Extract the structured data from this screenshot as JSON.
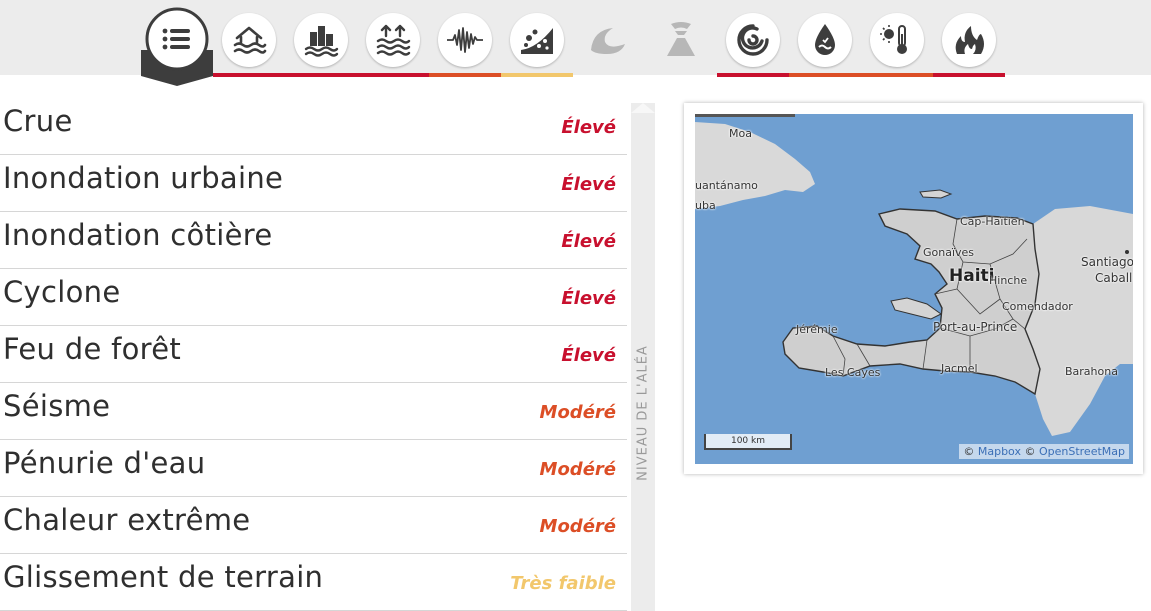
{
  "colors": {
    "high": "#c8102e",
    "medium": "#dc4e26",
    "very_low": "#f2c76c",
    "icon_dark": "#3d3d3d",
    "icon_disabled": "#b7b7b7"
  },
  "hazard_toolbar": {
    "list_icon": "list-icon",
    "icons": [
      {
        "name": "river-flood-icon",
        "level": "high"
      },
      {
        "name": "urban-flood-icon",
        "level": "high"
      },
      {
        "name": "coastal-flood-icon",
        "level": "high"
      },
      {
        "name": "earthquake-icon",
        "level": "medium"
      },
      {
        "name": "landslide-icon",
        "level": "very_low"
      },
      {
        "name": "tsunami-icon",
        "level": "none"
      },
      {
        "name": "volcano-icon",
        "level": "none"
      },
      {
        "name": "cyclone-icon",
        "level": "high"
      },
      {
        "name": "water-scarcity-icon",
        "level": "medium"
      },
      {
        "name": "extreme-heat-icon",
        "level": "medium"
      },
      {
        "name": "wildfire-icon",
        "level": "high"
      }
    ]
  },
  "hazards": [
    {
      "name": "Crue",
      "level": "Élevé",
      "severity": "high"
    },
    {
      "name": "Inondation urbaine",
      "level": "Élevé",
      "severity": "high"
    },
    {
      "name": "Inondation côtière",
      "level": "Élevé",
      "severity": "high"
    },
    {
      "name": "Cyclone",
      "level": "Élevé",
      "severity": "high"
    },
    {
      "name": "Feu de forêt",
      "level": "Élevé",
      "severity": "high"
    },
    {
      "name": "Séisme",
      "level": "Modéré",
      "severity": "medium"
    },
    {
      "name": "Pénurie d'eau",
      "level": "Modéré",
      "severity": "medium"
    },
    {
      "name": "Chaleur extrême",
      "level": "Modéré",
      "severity": "medium"
    },
    {
      "name": "Glissement de terrain",
      "level": "Très faible",
      "severity": "very_low"
    }
  ],
  "axis_label": "NIVEAU DE L'ALÉA",
  "map": {
    "labels": {
      "moa": "Moa",
      "guantanamo": "uantánamo",
      "cuba": "uba",
      "cap_haitien": "Cap-Haïtien",
      "gonaives": "Gonaïves",
      "haiti": "Haiti",
      "hinche": "Hinche",
      "santiago": "Santiago",
      "caballeros": "Caball",
      "comendador": "Comendador",
      "jeremie": "Jérémie",
      "port_au_prince": "Port-au-Prince",
      "les_cayes": "Les Cayes",
      "jacmel": "Jacmel",
      "barahona": "Barahona"
    },
    "scale": "100 km",
    "attribution": {
      "copy1": "©",
      "mapbox": "Mapbox",
      "copy2": "©",
      "osm": "OpenStreetMap"
    }
  }
}
